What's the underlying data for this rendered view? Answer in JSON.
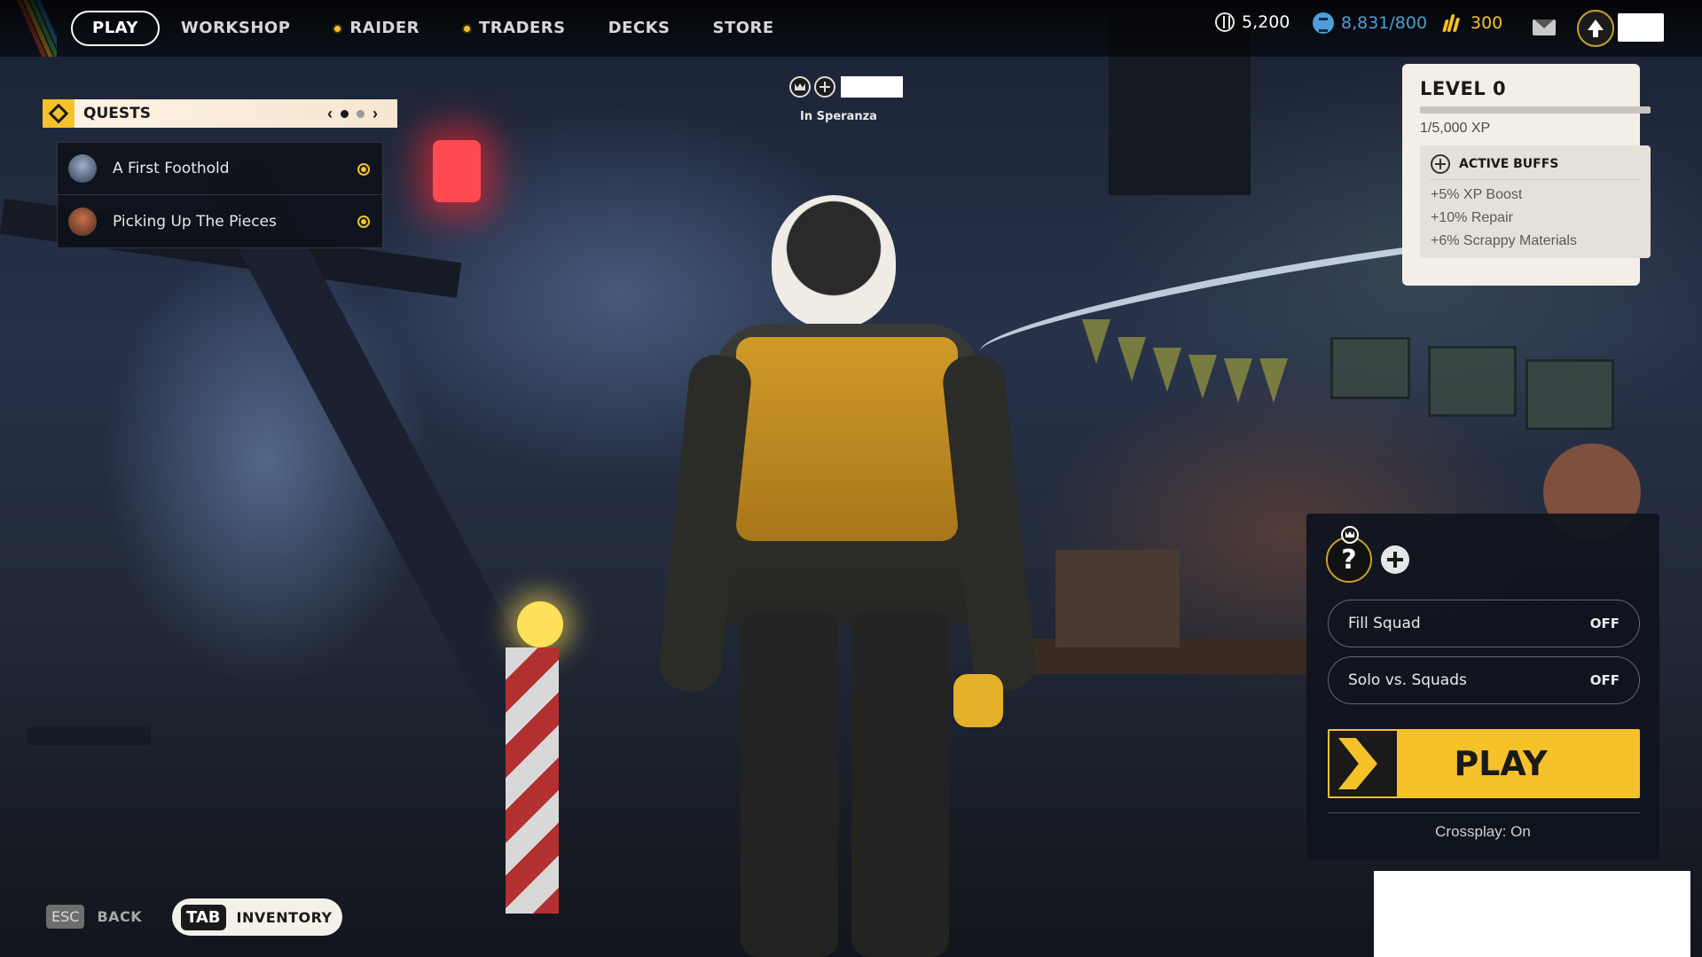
{
  "nav": {
    "items": [
      {
        "label": "PLAY",
        "active": true,
        "has_dot": false
      },
      {
        "label": "WORKSHOP",
        "active": false,
        "has_dot": false
      },
      {
        "label": "RAIDER",
        "active": false,
        "has_dot": true
      },
      {
        "label": "TRADERS",
        "active": false,
        "has_dot": true
      },
      {
        "label": "DECKS",
        "active": false,
        "has_dot": false
      },
      {
        "label": "STORE",
        "active": false,
        "has_dot": false
      }
    ]
  },
  "currencies": {
    "coins": "5,200",
    "credits": "8,831/800",
    "raider_tokens": "300"
  },
  "colors": {
    "accent": "#f5c22a",
    "credits": "#4d9ed8",
    "panel_light": "#f4efe6",
    "panel_dark": "#0e131e"
  },
  "quests": {
    "title": "QUESTS",
    "page": 1,
    "page_count": 3,
    "items": [
      {
        "label": "A First Foothold"
      },
      {
        "label": "Picking Up The Pieces"
      }
    ]
  },
  "location": {
    "label": "In Speranza"
  },
  "level": {
    "title": "LEVEL 0",
    "xp_text": "1/5,000 XP",
    "xp_fraction": 0.0002,
    "buffs_title": "ACTIVE BUFFS",
    "buffs": [
      "+5% XP Boost",
      "+10% Repair",
      "+6% Scrappy Materials"
    ]
  },
  "squad": {
    "slot_glyph": "?",
    "fill_squad_label": "Fill Squad",
    "fill_squad_state": "OFF",
    "solo_label": "Solo vs. Squads",
    "solo_state": "OFF",
    "play_label": "PLAY",
    "crossplay": "Crossplay: On"
  },
  "hints": {
    "esc_key": "ESC",
    "esc_label": "BACK",
    "tab_key": "TAB",
    "tab_label": "INVENTORY"
  },
  "icons": [
    "coin-icon",
    "credits-icon",
    "raider-token-icon",
    "mail-icon",
    "level-up-icon",
    "crown-icon",
    "plus-circle-icon",
    "play-arrow-icon"
  ]
}
